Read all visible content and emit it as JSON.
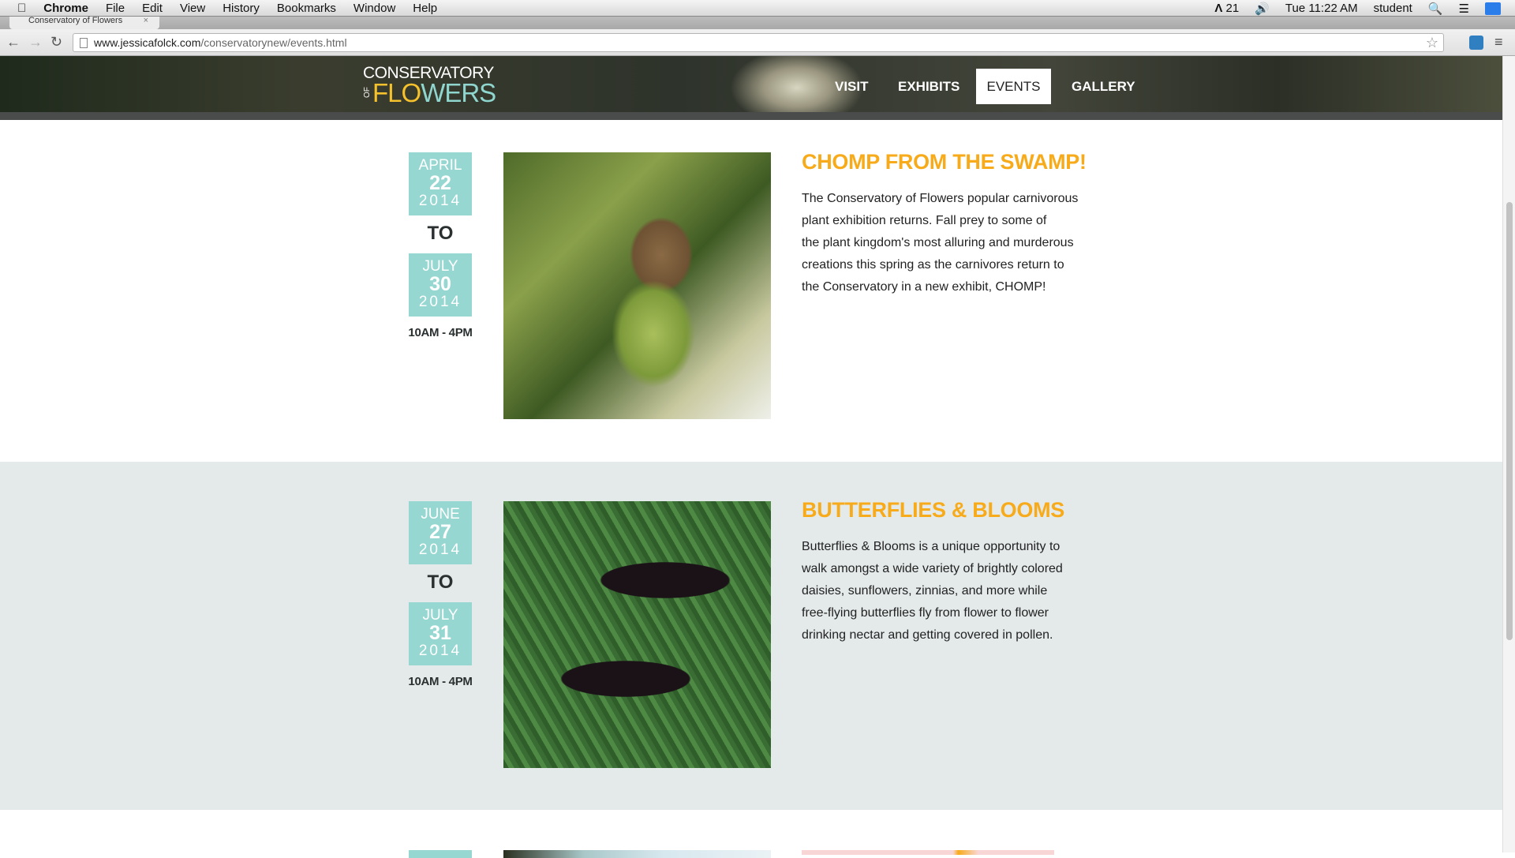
{
  "menubar": {
    "app": "Chrome",
    "items": [
      "File",
      "Edit",
      "View",
      "History",
      "Bookmarks",
      "Window",
      "Help"
    ],
    "adobe": "21",
    "clock": "Tue 11:22 AM",
    "user": "student"
  },
  "browser": {
    "tab_title": "Conservatory of Flowers",
    "url_domain": "www.jessicafolck.com",
    "url_path": "/conservatorynew/events.html"
  },
  "site": {
    "logo_line1": "CONSERVATORY",
    "logo_of": "OF",
    "logo_flowers_a": "FLO",
    "logo_flowers_b": "WERS",
    "nav": [
      "VISIT",
      "EXHIBITS",
      "EVENTS",
      "GALLERY"
    ],
    "active_nav": "EVENTS"
  },
  "events": [
    {
      "start": {
        "month": "APRIL",
        "day": "22",
        "year": "2014"
      },
      "to": "TO",
      "end": {
        "month": "JULY",
        "day": "30",
        "year": "2014"
      },
      "time": "10AM - 4PM",
      "title": "CHOMP FROM THE SWAMP!",
      "lines": [
        "The Conservatory of Flowers popular carnivorous",
        "plant exhibition returns. Fall prey to some of",
        "the plant kingdom's most alluring and murderous",
        "creations this spring as the carnivores return to",
        "the Conservatory in a new exhibit, CHOMP!"
      ]
    },
    {
      "start": {
        "month": "JUNE",
        "day": "27",
        "year": "2014"
      },
      "to": "TO",
      "end": {
        "month": "JULY",
        "day": "31",
        "year": "2014"
      },
      "time": "10AM - 4PM",
      "title": "BUTTERFLIES & BLOOMS",
      "lines": [
        "Butterflies & Blooms is a unique opportunity to",
        "walk amongst a wide variety of brightly colored",
        "daisies, sunflowers, zinnias, and more while",
        "free-flying butterflies fly from flower to flower",
        "drinking nectar and getting covered in pollen."
      ]
    }
  ],
  "colors": {
    "accent_teal": "#96d7d1",
    "title_orange": "#f7ab1a",
    "alt_row": "#e4e9e9"
  }
}
